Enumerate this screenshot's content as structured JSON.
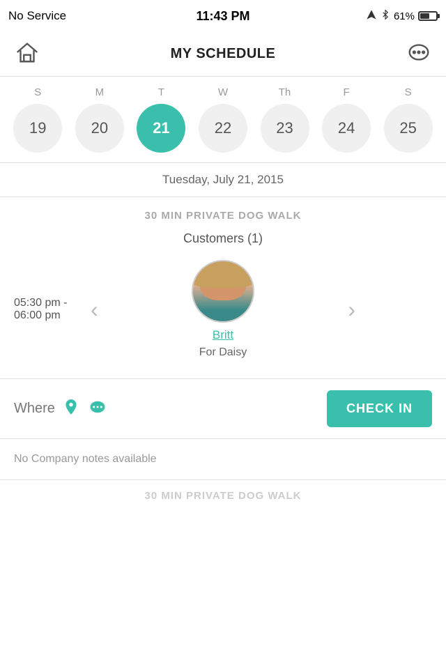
{
  "statusBar": {
    "carrier": "No Service",
    "time": "11:43 PM",
    "battery": "61%"
  },
  "header": {
    "title": "MY SCHEDULE",
    "homeLabel": "home",
    "chatLabel": "chat"
  },
  "calendar": {
    "days": [
      "S",
      "M",
      "T",
      "W",
      "Th",
      "F",
      "S"
    ],
    "dates": [
      19,
      20,
      21,
      22,
      23,
      24,
      25
    ],
    "selectedIndex": 2,
    "dateLabel": "Tuesday, July 21, 2015"
  },
  "appointment": {
    "title": "30 MIN PRIVATE DOG WALK",
    "customersLabel": "Customers (1)",
    "timeStart": "05:30 pm -",
    "timeEnd": "06:00 pm",
    "customerName": "Britt",
    "petLabel": "For Daisy",
    "whereLabel": "Where",
    "checkInLabel": "CHECK IN",
    "notesText": "No Company notes available"
  },
  "secondAppt": {
    "title": "30 MIN PRIVATE DOG WALK"
  }
}
